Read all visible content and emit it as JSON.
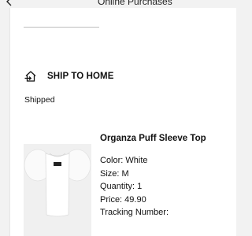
{
  "header": {
    "title": "Online Purchases"
  },
  "shipping": {
    "icon": "ship-to-home-icon",
    "label": "SHIP TO HOME",
    "status": "Shipped"
  },
  "item": {
    "name": "Organza Puff Sleeve Top",
    "color": "Color: White",
    "size": "Size: M",
    "quantity": "Quantity: 1",
    "price": "Price: 49.90",
    "tracking": "Tracking Number:"
  }
}
